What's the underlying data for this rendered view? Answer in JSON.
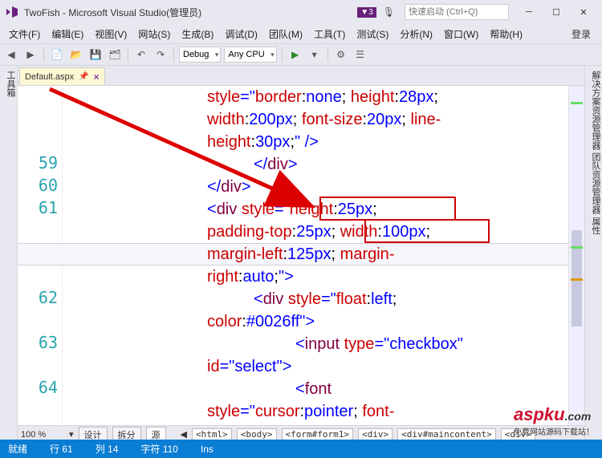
{
  "title": "TwoFish - Microsoft Visual Studio(管理员)",
  "quick_launch_placeholder": "快速启动 (Ctrl+Q)",
  "notify_badge": "▼3",
  "menu": [
    "文件(F)",
    "编辑(E)",
    "视图(V)",
    "网站(S)",
    "生成(B)",
    "调试(D)",
    "团队(M)",
    "工具(T)",
    "测试(S)",
    "分析(N)",
    "窗口(W)",
    "帮助(H)"
  ],
  "login_label": "登录",
  "toolbar": {
    "config": "Debug",
    "platform": "Any CPU"
  },
  "left_rail": "工具箱",
  "right_rail": "解决方案资源管理器  团队资源管理器  属性",
  "tab": {
    "name": "Default.aspx",
    "pin": "📌",
    "close": "×"
  },
  "code_lines": {
    "pre": [
      "style=\"border:none; height:28px;",
      "width:200px; font-size:20px; line-",
      "height:30px;\" />"
    ],
    "l59": "</div>",
    "l60": "</div>",
    "l61a": "<div style=\"",
    "l61b": "height:25px;",
    "l61c": "padding-top:25px; ",
    "l61d": "width:100px;",
    "l61e": "margin-left:125px; margin-",
    "l61f": "right:auto;\">",
    "l62a": "<div style=\"float:left;",
    "l62b": "color:#0026ff\">",
    "l63a": "<input type=\"checkbox\"",
    "l63b": "id=\"select\">",
    "l64a": "<font",
    "l64b": "style=\"cursor:pointer; font-"
  },
  "line_numbers": [
    "59",
    "60",
    "61",
    "62",
    "63",
    "64"
  ],
  "bottom": {
    "zoom": "100 %",
    "tabs": [
      "设计",
      "拆分",
      "源"
    ],
    "crumbs": [
      "<html>",
      "<body>",
      "<form#form1>",
      "<div>",
      "<div#maincontent>",
      "<div>"
    ]
  },
  "status": {
    "ready": "就绪",
    "line": "行 61",
    "col": "列 14",
    "ch": "字符 110",
    "ins": "Ins"
  },
  "watermark": {
    "main": "aspku",
    "top": ".com",
    "sub": "免费网站源码下载站！"
  }
}
